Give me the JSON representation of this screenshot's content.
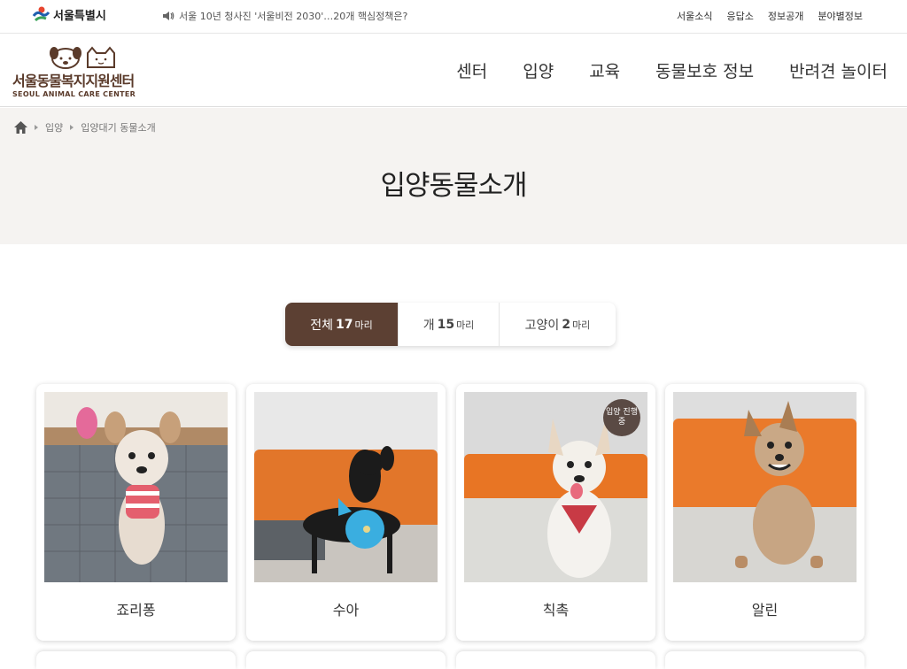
{
  "topbar": {
    "seoul_logo": "서울특별시",
    "news": "서울 10년 청사진 '서울비전 2030'…20개 핵심정책은?",
    "links": [
      "서울소식",
      "응답소",
      "정보공개",
      "분야별정보"
    ]
  },
  "header": {
    "brand_name": "서울동물복지지원센터",
    "brand_sub": "SEOUL ANIMAL CARE CENTER",
    "nav": [
      "센터",
      "입양",
      "교육",
      "동물보호 정보",
      "반려견 놀이터"
    ]
  },
  "breadcrumb": [
    "입양",
    "입양대기 동물소개"
  ],
  "page_title": "입양동물소개",
  "tabs": [
    {
      "label": "전체",
      "count": "17",
      "unit": "마리",
      "active": true
    },
    {
      "label": "개",
      "count": "15",
      "unit": "마리",
      "active": false
    },
    {
      "label": "고양이",
      "count": "2",
      "unit": "마리",
      "active": false
    }
  ],
  "animals": [
    {
      "name": "죠리퐁"
    },
    {
      "name": "수아"
    },
    {
      "name": "칙촉",
      "badge": "입양 진행중"
    },
    {
      "name": "알린"
    }
  ],
  "colors": {
    "accent": "#5c4033",
    "band": "#f5f3f1"
  }
}
